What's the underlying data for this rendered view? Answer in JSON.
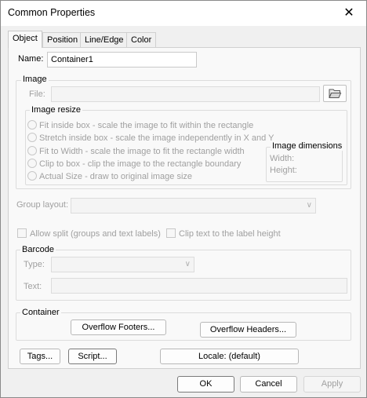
{
  "window": {
    "title": "Common Properties",
    "close_glyph": "✕"
  },
  "tabs": [
    {
      "label": "Object",
      "active": true
    },
    {
      "label": "Position",
      "active": false
    },
    {
      "label": "Line/Edge",
      "active": false
    },
    {
      "label": "Color",
      "active": false
    }
  ],
  "name": {
    "label": "Name:",
    "value": "Container1"
  },
  "image": {
    "title": "Image",
    "file_label": "File:",
    "file_value": "",
    "browse_icon": "folder-open-icon",
    "resize": {
      "title": "Image resize",
      "options": [
        "Fit inside box - scale the image to fit within the rectangle",
        "Stretch inside box - scale the image independently in X and Y",
        "Fit to Width - scale the image to fit the rectangle width",
        "Clip to box - clip the image to the rectangle boundary",
        "Actual Size - draw to original image size"
      ]
    },
    "dimensions": {
      "title": "Image dimensions",
      "width_label": "Width:",
      "height_label": "Height:"
    }
  },
  "group_layout": {
    "label": "Group layout:",
    "value": ""
  },
  "allow_split": {
    "label": "Allow split (groups and text labels)",
    "checked": false
  },
  "clip_text": {
    "label": "Clip text to the label height",
    "checked": false
  },
  "barcode": {
    "title": "Barcode",
    "type_label": "Type:",
    "type_value": "",
    "text_label": "Text:",
    "text_value": ""
  },
  "container": {
    "title": "Container",
    "overflow_footers": "Overflow Footers...",
    "overflow_headers": "Overflow Headers..."
  },
  "buttons": {
    "tags": "Tags...",
    "script": "Script...",
    "locale": "Locale: (default)"
  },
  "footer": {
    "ok": "OK",
    "cancel": "Cancel",
    "apply": "Apply"
  },
  "colors": {
    "disabled_text": "#a0a0a0",
    "panel": "#f9f9f9",
    "window": "#f0f0f0"
  }
}
